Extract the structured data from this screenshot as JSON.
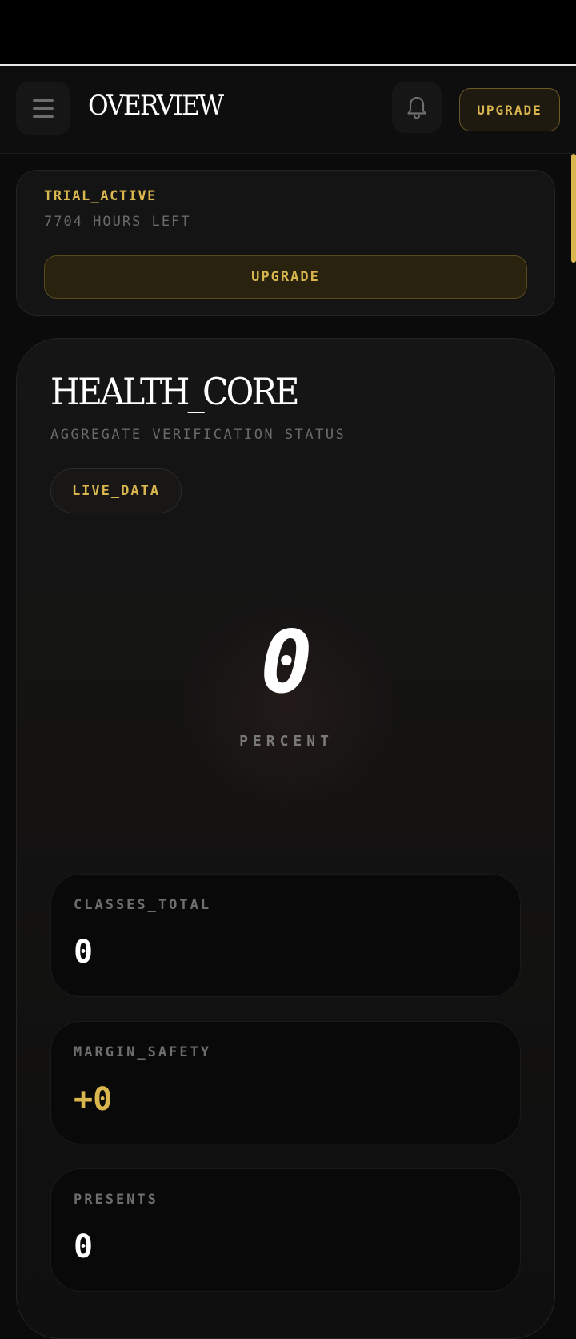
{
  "header": {
    "title": "OVERVIEW",
    "upgrade_label": "UPGRADE"
  },
  "trial": {
    "status": "TRIAL_ACTIVE",
    "hours_left": "7704 HOURS LEFT",
    "upgrade_label": "UPGRADE"
  },
  "health": {
    "title": "HEALTH_CORE",
    "subtitle": "AGGREGATE VERIFICATION STATUS",
    "live_badge": "LIVE_DATA",
    "percent_value": "0",
    "percent_label": "PERCENT",
    "stats": [
      {
        "label": "CLASSES_TOTAL",
        "value": "0"
      },
      {
        "label": "MARGIN_SAFETY",
        "value": "+0"
      },
      {
        "label": "PRESENTS",
        "value": "0"
      }
    ]
  },
  "colors": {
    "accent": "#d9b64e",
    "background": "#0b0b0b"
  },
  "icons": [
    "menu-icon",
    "bell-icon"
  ]
}
